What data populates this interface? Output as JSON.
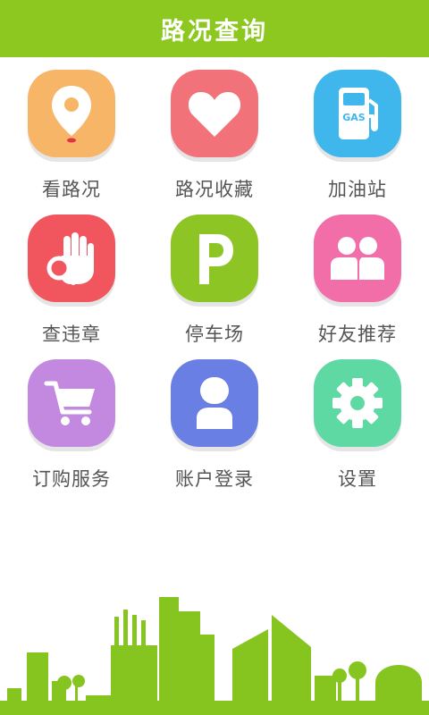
{
  "header": {
    "title": "路况查询"
  },
  "menu": [
    {
      "id": "view-traffic",
      "label": "看路况",
      "icon": "map-pin-icon",
      "color": "#f7b567"
    },
    {
      "id": "traffic-favorites",
      "label": "路况收藏",
      "icon": "heart-icon",
      "color": "#f2727a"
    },
    {
      "id": "gas-station",
      "label": "加油站",
      "icon": "gas-pump-icon",
      "color": "#3fb6ec"
    },
    {
      "id": "violation-query",
      "label": "查违章",
      "icon": "hand-search-icon",
      "color": "#f1555e"
    },
    {
      "id": "parking",
      "label": "停车场",
      "icon": "parking-icon",
      "color": "#8dc624"
    },
    {
      "id": "recommend-friends",
      "label": "好友推荐",
      "icon": "users-icon",
      "color": "#f26ea8"
    },
    {
      "id": "order-service",
      "label": "订购服务",
      "icon": "cart-icon",
      "color": "#c388df"
    },
    {
      "id": "account-login",
      "label": "账户登录",
      "icon": "user-icon",
      "color": "#6a7fe3"
    },
    {
      "id": "settings",
      "label": "设置",
      "icon": "gear-icon",
      "color": "#5ed9a4"
    }
  ],
  "colors": {
    "header": "#8cc820",
    "skyline": "#86c51f",
    "label": "#555555"
  }
}
